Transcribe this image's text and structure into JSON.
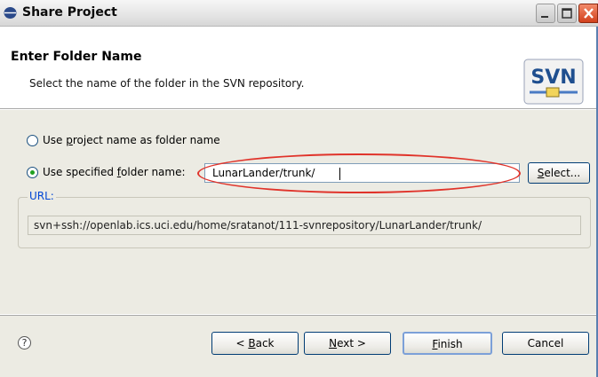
{
  "window": {
    "title": "Share Project",
    "icon": "svn-share-icon",
    "controls": [
      "minimize-icon",
      "maximize-icon",
      "close-icon"
    ]
  },
  "header": {
    "title": "Enter Folder Name",
    "description": "Select the name of the folder in the SVN repository.",
    "logo_text": "SVN"
  },
  "options": {
    "use_project_name": {
      "prefix": "Use ",
      "mnemonic": "p",
      "rest": "roject name as folder name",
      "selected": false
    },
    "use_specified_name": {
      "prefix": "Use specified ",
      "mnemonic": "f",
      "rest": "older name:",
      "selected": true
    }
  },
  "folder_input": {
    "value": "LunarLander/trunk/"
  },
  "select_button": {
    "mnemonic": "S",
    "rest": "elect..."
  },
  "url_group": {
    "legend": "URL:",
    "value": "svn+ssh://openlab.ics.uci.edu/home/sratanot/111-svnrepository/LunarLander/trunk/"
  },
  "footer": {
    "help_symbol": "?",
    "back": {
      "prefix": "< ",
      "mnemonic": "B",
      "rest": "ack"
    },
    "next": {
      "mnemonic": "N",
      "rest": "ext >"
    },
    "finish": {
      "mnemonic": "F",
      "rest": "inish"
    },
    "cancel": "Cancel"
  },
  "colors": {
    "annotation_ellipse": "#e0332a",
    "dialog_background": "#ecebe3",
    "selected_radio": "#21a121"
  }
}
